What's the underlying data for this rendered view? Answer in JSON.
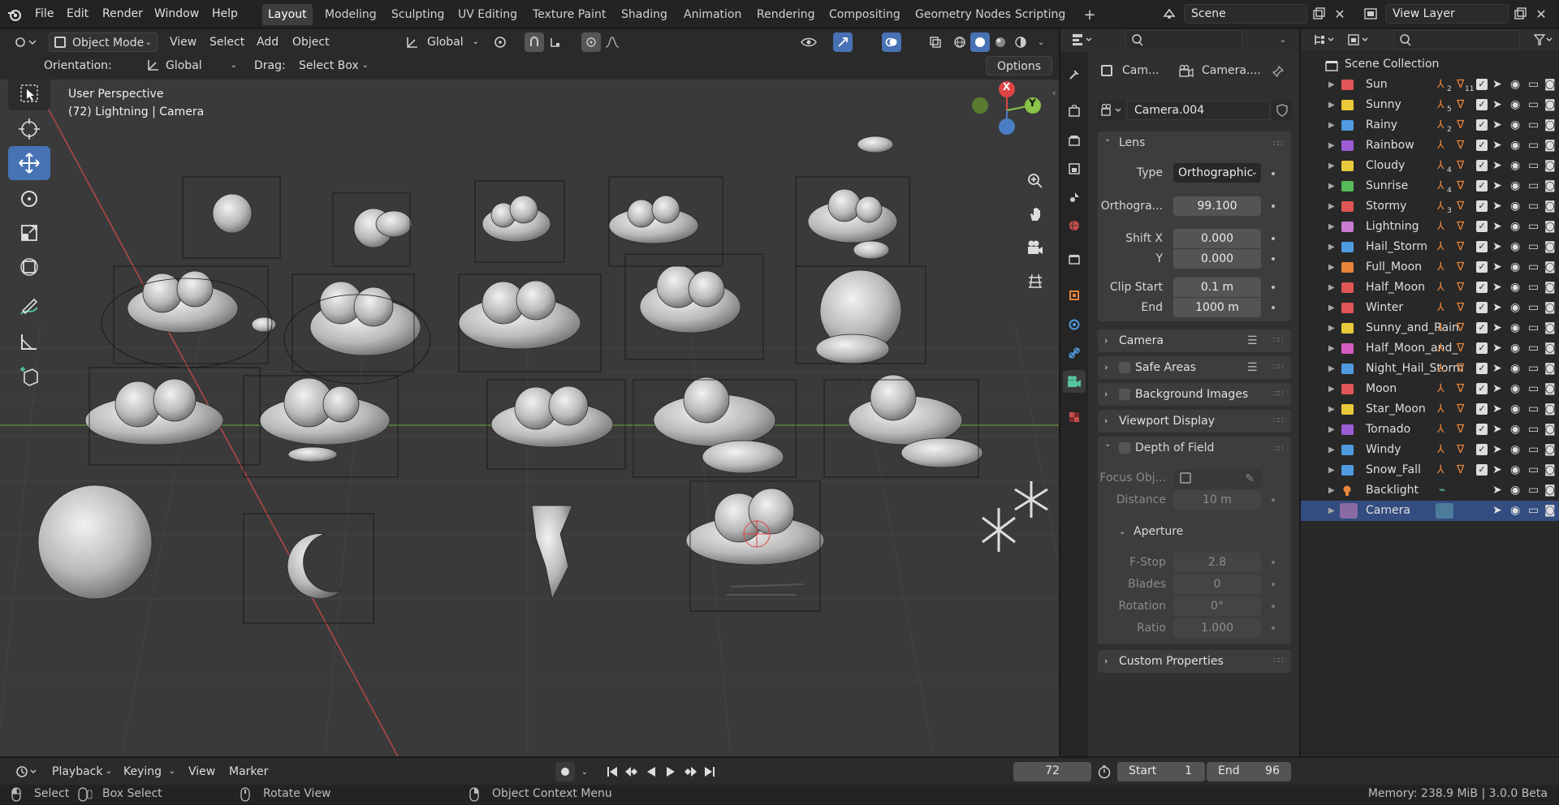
{
  "app": {
    "icon": "blender-logo-icon"
  },
  "menu": [
    "File",
    "Edit",
    "Render",
    "Window",
    "Help"
  ],
  "workspaces": [
    "Layout",
    "Modeling",
    "Sculpting",
    "UV Editing",
    "Texture Paint",
    "Shading",
    "Animation",
    "Rendering",
    "Compositing",
    "Geometry Nodes",
    "Scripting"
  ],
  "scene": {
    "label": "Scene"
  },
  "view_layer": {
    "label": "View Layer"
  },
  "viewport_header": {
    "mode": "Object Mode",
    "view": "View",
    "select": "Select",
    "add": "Add",
    "object": "Object",
    "transform_orientation": "Global",
    "options": "Options"
  },
  "tool_settings": {
    "orientation_label": "Orientation:",
    "orientation_value": "Global",
    "drag_label": "Drag:",
    "drag_value": "Select Box"
  },
  "viewport": {
    "perspective": "User Perspective",
    "object_info": "(72) Lightning | Camera",
    "axis_x": "X",
    "axis_y": "Y"
  },
  "properties": {
    "breadcrumb_object": "Cam...",
    "breadcrumb_data": "Camera....",
    "data_name": "Camera.004",
    "lens": {
      "title": "Lens",
      "type_label": "Type",
      "type_value": "Orthographic",
      "ortho_label": "Orthogra...",
      "ortho_value": "99.100",
      "shift_x_label": "Shift X",
      "shift_x_value": "0.000",
      "shift_y_label": "Y",
      "shift_y_value": "0.000",
      "clip_start_label": "Clip Start",
      "clip_start_value": "0.1 m",
      "clip_end_label": "End",
      "clip_end_value": "1000 m"
    },
    "panels": {
      "camera": "Camera",
      "safe_areas": "Safe Areas",
      "background_images": "Background Images",
      "viewport_display": "Viewport Display",
      "dof": "Depth of Field",
      "custom_props": "Custom Properties"
    },
    "dof": {
      "focus_label": "Focus Obj...",
      "distance_label": "Distance",
      "distance_value": "10 m",
      "aperture_title": "Aperture",
      "fstop_label": "F-Stop",
      "fstop_value": "2.8",
      "blades_label": "Blades",
      "blades_value": "0",
      "rotation_label": "Rotation",
      "rotation_value": "0°",
      "ratio_label": "Ratio",
      "ratio_value": "1.000"
    }
  },
  "outliner": {
    "root": "Scene Collection",
    "items": [
      {
        "name": "Sun",
        "color": "#e05555",
        "badge": "2",
        "badge2": "11"
      },
      {
        "name": "Sunny",
        "color": "#e8c93a",
        "badge": "5",
        "badge2": ""
      },
      {
        "name": "Rainy",
        "color": "#4f9be0",
        "badge": "2",
        "badge2": ""
      },
      {
        "name": "Rainbow",
        "color": "#9b5cd6",
        "badge": "",
        "badge2": ""
      },
      {
        "name": "Cloudy",
        "color": "#e8c93a",
        "badge": "4",
        "badge2": ""
      },
      {
        "name": "Sunrise",
        "color": "#56b95a",
        "badge": "4",
        "badge2": ""
      },
      {
        "name": "Stormy",
        "color": "#e05555",
        "badge": "3",
        "badge2": ""
      },
      {
        "name": "Lightning",
        "color": "#c87bd1",
        "badge": "",
        "badge2": ""
      },
      {
        "name": "Hail_Storm",
        "color": "#4f9be0",
        "badge": "",
        "badge2": ""
      },
      {
        "name": "Full_Moon",
        "color": "#e8853a",
        "badge": "",
        "badge2": ""
      },
      {
        "name": "Half_Moon",
        "color": "#e05555",
        "badge": "",
        "badge2": ""
      },
      {
        "name": "Winter",
        "color": "#e05555",
        "badge": "",
        "badge2": ""
      },
      {
        "name": "Sunny_and_Rain",
        "color": "#e8c93a",
        "badge": "",
        "badge2": ""
      },
      {
        "name": "Half_Moon_and_",
        "color": "#d45ec0",
        "badge": "",
        "badge2": ""
      },
      {
        "name": "Night_Hail_Storm",
        "color": "#4f9be0",
        "badge": "",
        "badge2": ""
      },
      {
        "name": "Moon",
        "color": "#e05555",
        "badge": "",
        "badge2": ""
      },
      {
        "name": "Star_Moon",
        "color": "#e8c93a",
        "badge": "",
        "badge2": ""
      },
      {
        "name": "Tornado",
        "color": "#9b5cd6",
        "badge": "",
        "badge2": ""
      },
      {
        "name": "Windy",
        "color": "#4f9be0",
        "badge": "",
        "badge2": ""
      },
      {
        "name": "Snow_Fall",
        "color": "#4f9be0",
        "badge": "",
        "badge2": ""
      },
      {
        "name": "Backlight",
        "color": "",
        "badge": "",
        "badge2": ""
      },
      {
        "name": "Camera",
        "color": "",
        "badge": "",
        "badge2": ""
      }
    ]
  },
  "timeline": {
    "playback": "Playback",
    "keying": "Keying",
    "view": "View",
    "marker": "Marker",
    "current_frame": "72",
    "start_label": "Start",
    "start_value": "1",
    "end_label": "End",
    "end_value": "96"
  },
  "status": {
    "select": "Select",
    "box_select": "Box Select",
    "rotate_view": "Rotate View",
    "context_menu": "Object Context Menu",
    "memory": "Memory: 238.9 MiB | 3.0.0 Beta"
  }
}
